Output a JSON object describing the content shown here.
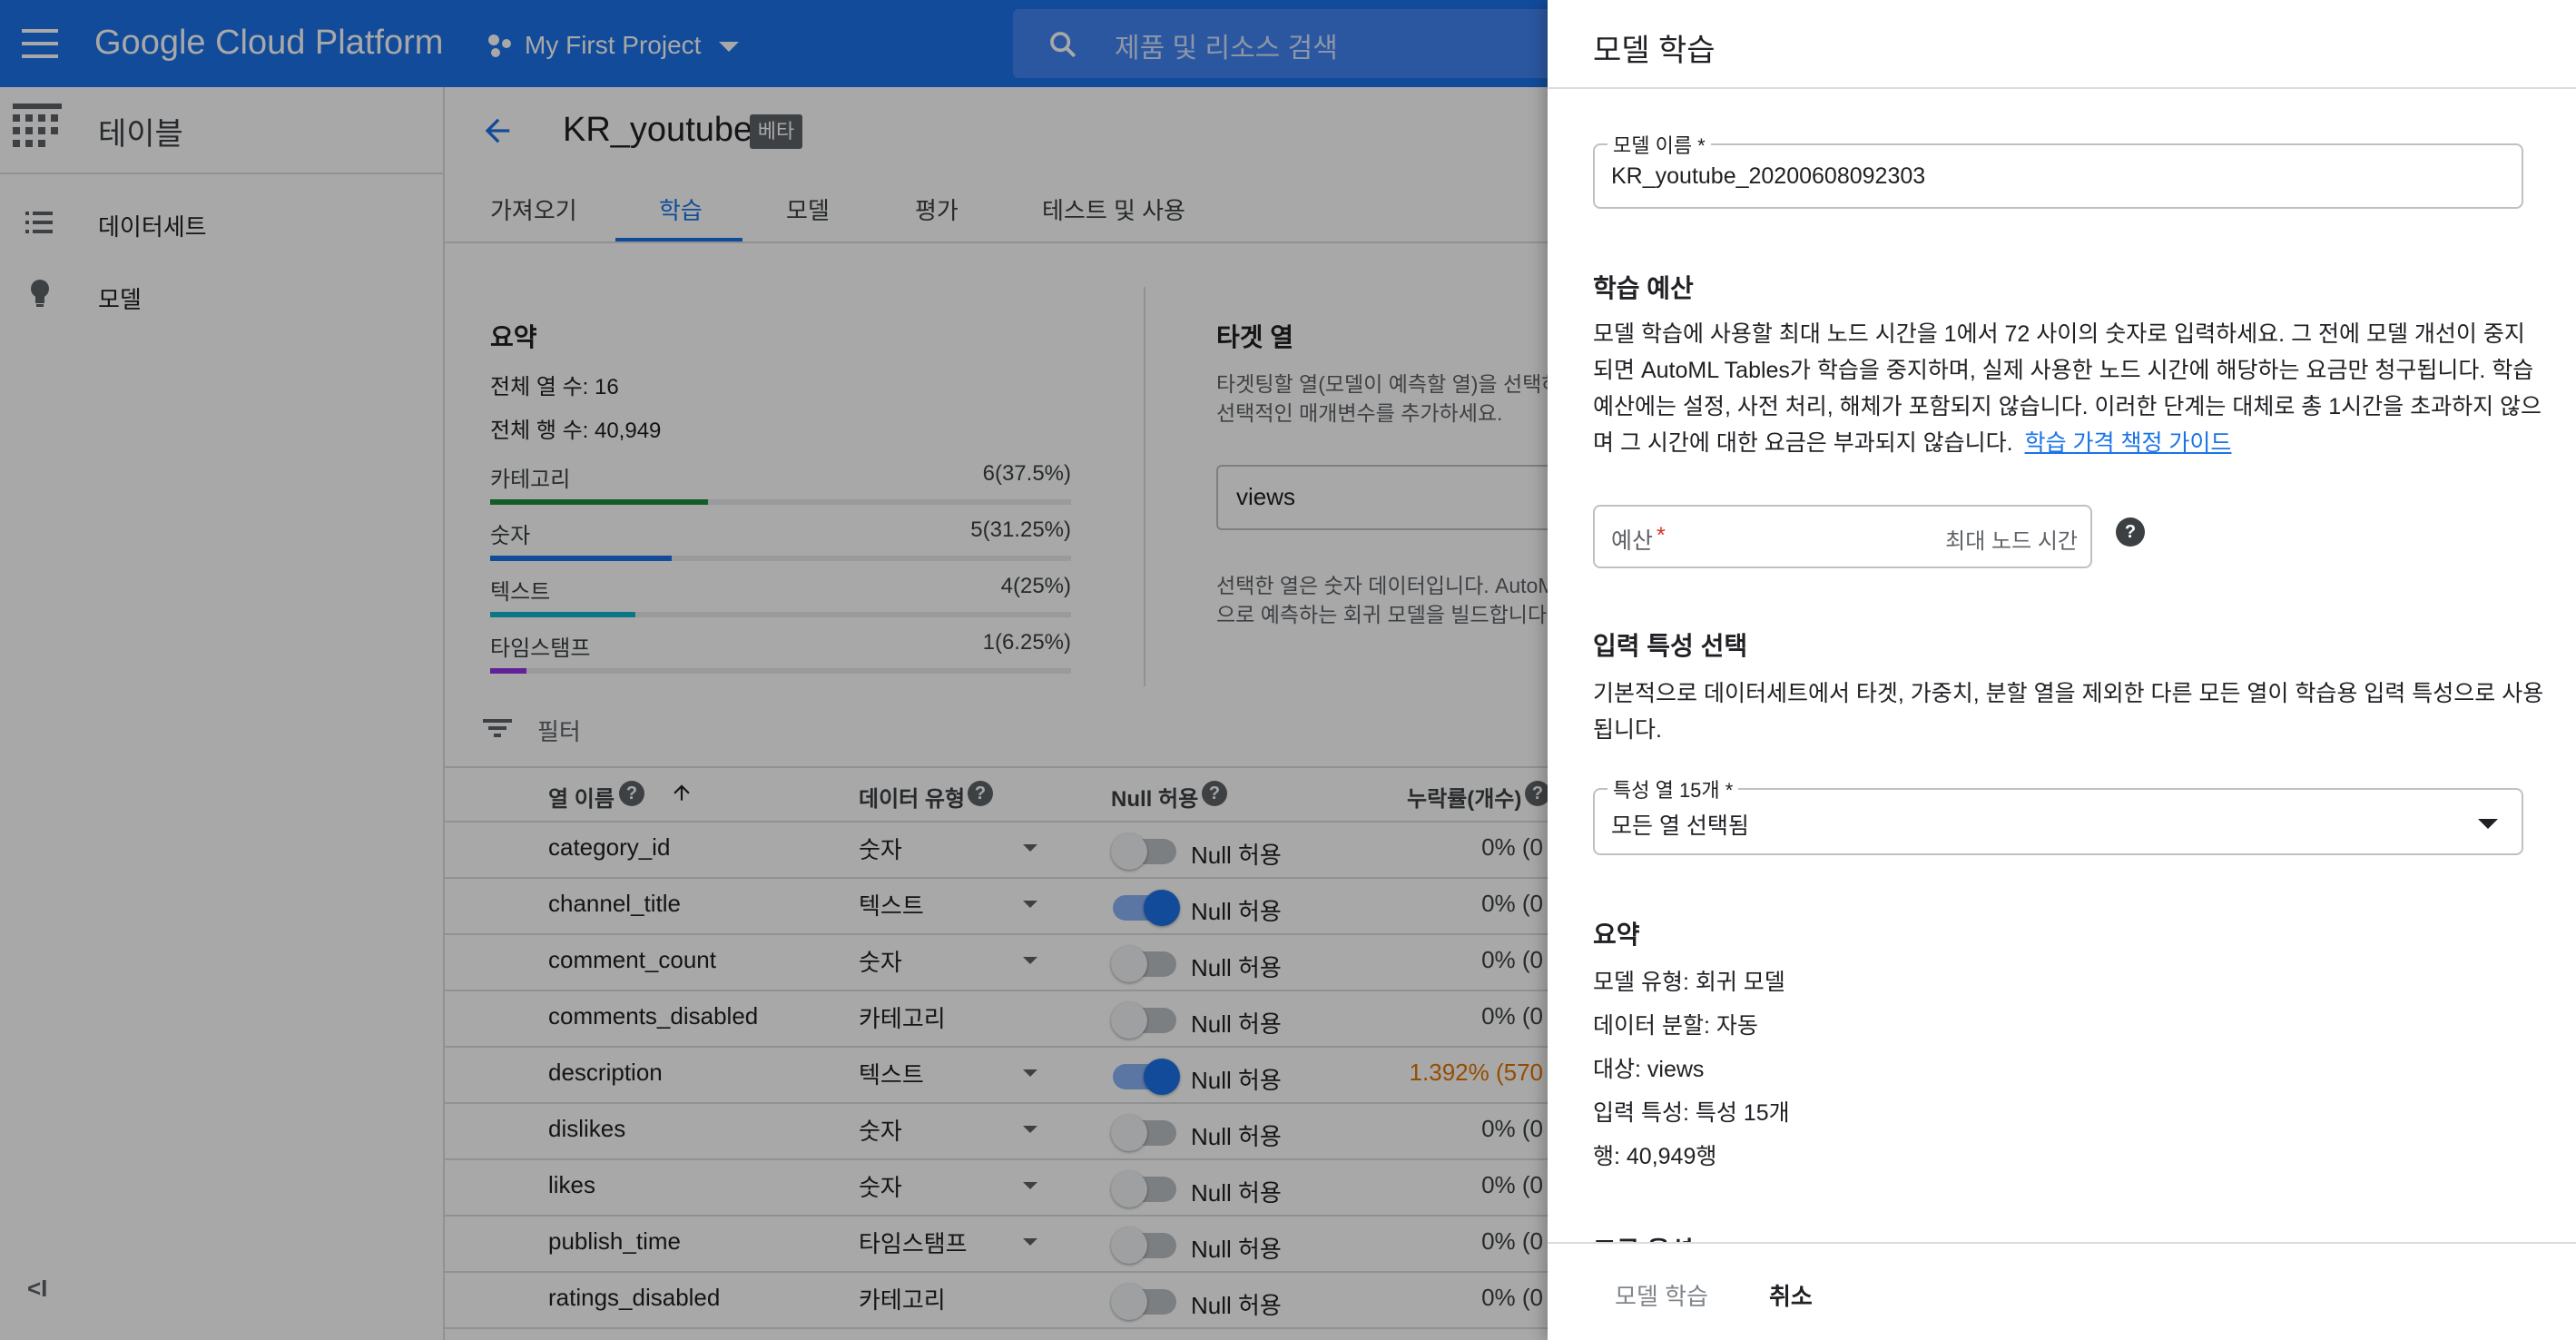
{
  "topbar": {
    "brand": "Google Cloud Platform",
    "project": "My First Project",
    "search_placeholder": "제품 및 리소스 검색"
  },
  "nav": {
    "title": "테이블",
    "items": [
      {
        "label": "데이터세트",
        "icon": "list-icon"
      },
      {
        "label": "모델",
        "icon": "lightbulb-icon"
      }
    ],
    "collapse": "<I"
  },
  "header": {
    "title": "KR_youtube",
    "badge": "베타"
  },
  "tabs": [
    "가져오기",
    "학습",
    "모델",
    "평가",
    "테스트 및 사용"
  ],
  "active_tab_index": 1,
  "summary": {
    "heading": "요약",
    "total_columns": "전체 열 수: 16",
    "total_rows": "전체 행 수: 40,949",
    "types": [
      {
        "label": "카테고리",
        "value": "6(37.5%)",
        "fraction": 0.375,
        "color": "#1e8e3e"
      },
      {
        "label": "숫자",
        "value": "5(31.25%)",
        "fraction": 0.3125,
        "color": "#1a73e8"
      },
      {
        "label": "텍스트",
        "value": "4(25%)",
        "fraction": 0.25,
        "color": "#12b5cb"
      },
      {
        "label": "타임스탬프",
        "value": "1(6.25%)",
        "fraction": 0.0625,
        "color": "#9334e6"
      }
    ]
  },
  "target": {
    "heading": "타겟 열",
    "desc1": "타겟팅할 열(모델이 예측할 열)을 선택하",
    "desc2": "선택적인 매개변수를 추가하세요.",
    "value": "views",
    "note1": "선택한 열은 숫자 데이터입니다. AutoM",
    "note2": "으로 예측하는 회귀 모델을 빌드합니다."
  },
  "filter": {
    "label": "필터"
  },
  "table": {
    "headers": {
      "name": "열 이름",
      "type": "데이터 유형",
      "null": "Null 허용",
      "missing": "누락률(개수)"
    },
    "rows": [
      {
        "name": "category_id",
        "type": "숫자",
        "dropdown": true,
        "null_on": false,
        "null_label": "Null 허용",
        "missing": "0% (0",
        "missing_color": "#3c4043"
      },
      {
        "name": "channel_title",
        "type": "텍스트",
        "dropdown": true,
        "null_on": true,
        "null_label": "Null 허용",
        "missing": "0% (0",
        "missing_color": "#3c4043"
      },
      {
        "name": "comment_count",
        "type": "숫자",
        "dropdown": true,
        "null_on": false,
        "null_label": "Null 허용",
        "missing": "0% (0",
        "missing_color": "#3c4043"
      },
      {
        "name": "comments_disabled",
        "type": "카테고리",
        "dropdown": false,
        "null_on": false,
        "null_label": "Null 허용",
        "missing": "0% (0",
        "missing_color": "#3c4043"
      },
      {
        "name": "description",
        "type": "텍스트",
        "dropdown": true,
        "null_on": true,
        "null_label": "Null 허용",
        "missing": "1.392% (570",
        "missing_color": "#e37400"
      },
      {
        "name": "dislikes",
        "type": "숫자",
        "dropdown": true,
        "null_on": false,
        "null_label": "Null 허용",
        "missing": "0% (0",
        "missing_color": "#3c4043"
      },
      {
        "name": "likes",
        "type": "숫자",
        "dropdown": true,
        "null_on": false,
        "null_label": "Null 허용",
        "missing": "0% (0",
        "missing_color": "#3c4043"
      },
      {
        "name": "publish_time",
        "type": "타임스탬프",
        "dropdown": true,
        "null_on": false,
        "null_label": "Null 허용",
        "missing": "0% (0",
        "missing_color": "#3c4043"
      },
      {
        "name": "ratings_disabled",
        "type": "카테고리",
        "dropdown": false,
        "null_on": false,
        "null_label": "Null 허용",
        "missing": "0% (0",
        "missing_color": "#3c4043"
      }
    ]
  },
  "panel": {
    "title": "모델 학습",
    "model_name_label": "모델 이름 *",
    "model_name_value": "KR_youtube_20200608092303",
    "budget_heading": "학습 예산",
    "budget_desc": [
      "모델 학습에 사용할 최대 노드 시간을 1에서 72 사이의 숫자로 입력하세요. 그 전에 모델 개선이 중지",
      "되면 AutoML Tables가 학습을 중지하며, 실제 사용한 노드 시간에 해당하는 요금만 청구됩니다. 학습",
      "예산에는 설정, 사전 처리, 해체가 포함되지 않습니다. 이러한 단계는 대체로 총 1시간을 초과하지 않으",
      "며 그 시간에 대한 요금은 부과되지 않습니다."
    ],
    "budget_link": "학습 가격 책정 가이드",
    "budget_placeholder": "예산",
    "budget_required": "*",
    "budget_suffix": "최대 노드 시간",
    "features_heading": "입력 특성 선택",
    "features_desc": [
      "기본적으로 데이터세트에서 타겟, 가중치, 분할 열을 제외한 다른 모든 열이 학습용 입력 특성으로 사용",
      "됩니다."
    ],
    "features_label": "특성 열 15개 *",
    "features_value": "모든 열 선택됨",
    "summary_heading": "요약",
    "summary_lines": [
      "모델 유형: 회귀 모델",
      "데이터 분할: 자동",
      "대상: views",
      "입력 특성: 특성 15개",
      "행: 40,949행"
    ],
    "partial_heading": "고급 옵션",
    "train_button": "모델 학습",
    "cancel_button": "취소"
  }
}
